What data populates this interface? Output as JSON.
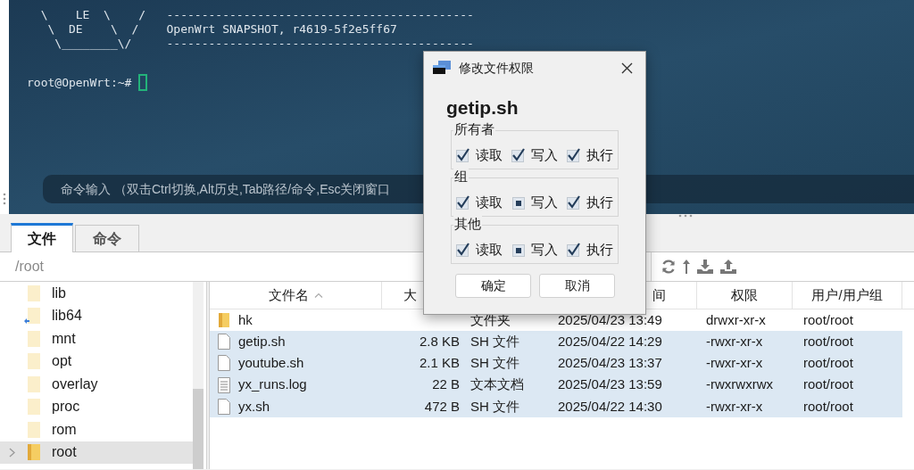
{
  "terminal": {
    "banner_lines": [
      "  \\    LE  \\    /   --------------------------------------------",
      "   \\  DE    \\  /    OpenWrt SNAPSHOT, r4619-5f2e5ff67",
      "    \\________\\/     --------------------------------------------"
    ],
    "prompt": "root@OpenWrt:~#",
    "command_hint": "命令输入 （双击Ctrl切换,Alt历史,Tab路径/命令,Esc关闭窗口"
  },
  "tabs": [
    {
      "label": "文件",
      "selected": true
    },
    {
      "label": "命令",
      "selected": false
    }
  ],
  "path": "/root",
  "tree": [
    {
      "name": "lib",
      "kind": "folder",
      "selected": false,
      "has_children": false
    },
    {
      "name": "lib64",
      "kind": "link",
      "selected": false,
      "has_children": false
    },
    {
      "name": "mnt",
      "kind": "folder",
      "selected": false,
      "has_children": false
    },
    {
      "name": "opt",
      "kind": "folder",
      "selected": false,
      "has_children": false
    },
    {
      "name": "overlay",
      "kind": "folder",
      "selected": false,
      "has_children": false
    },
    {
      "name": "proc",
      "kind": "folder",
      "selected": false,
      "has_children": false
    },
    {
      "name": "rom",
      "kind": "folder",
      "selected": false,
      "has_children": false
    },
    {
      "name": "root",
      "kind": "folder",
      "selected": true,
      "has_children": true
    }
  ],
  "file_list": {
    "columns": [
      {
        "label": "文件名",
        "sorted": true
      },
      {
        "label": "大"
      },
      {},
      {
        "label": "间"
      },
      {
        "label": "权限"
      },
      {
        "label": "用户/用户组"
      }
    ],
    "rows": [
      {
        "kind": "folder",
        "selected": false,
        "cells": [
          "hk",
          "",
          "文件夹",
          "2025/04/23 13:49",
          "drwxr-xr-x",
          "root/root"
        ]
      },
      {
        "kind": "file",
        "selected": true,
        "cells": [
          "getip.sh",
          "2.8 KB",
          "SH 文件",
          "2025/04/22 14:29",
          "-rwxr-xr-x",
          "root/root"
        ]
      },
      {
        "kind": "file",
        "selected": true,
        "cells": [
          "youtube.sh",
          "2.1 KB",
          "SH 文件",
          "2025/04/23 13:37",
          "-rwxr-xr-x",
          "root/root"
        ]
      },
      {
        "kind": "text",
        "selected": true,
        "cells": [
          "yx_runs.log",
          "22 B",
          "文本文档",
          "2025/04/23 13:59",
          "-rwxrwxrwx",
          "root/root"
        ]
      },
      {
        "kind": "file",
        "selected": true,
        "cells": [
          "yx.sh",
          "472 B",
          "SH 文件",
          "2025/04/22 14:30",
          "-rwxr-xr-x",
          "root/root"
        ]
      }
    ]
  },
  "dialog": {
    "title": "修改文件权限",
    "filename": "getip.sh",
    "groups": [
      {
        "label": "所有者",
        "perms": [
          {
            "label": "读取",
            "checked": true
          },
          {
            "label": "写入",
            "checked": true
          },
          {
            "label": "执行",
            "checked": true
          }
        ]
      },
      {
        "label": "组",
        "perms": [
          {
            "label": "读取",
            "checked": true
          },
          {
            "label": "写入",
            "checked": false
          },
          {
            "label": "执行",
            "checked": true
          }
        ]
      },
      {
        "label": "其他",
        "perms": [
          {
            "label": "读取",
            "checked": true
          },
          {
            "label": "写入",
            "checked": false
          },
          {
            "label": "执行",
            "checked": true
          }
        ]
      }
    ],
    "buttons": [
      "确定",
      "取消"
    ]
  }
}
